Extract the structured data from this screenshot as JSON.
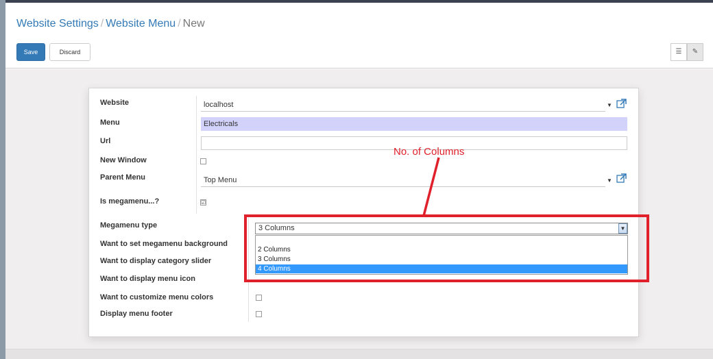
{
  "breadcrumb": {
    "items": [
      "Website Settings",
      "Website Menu"
    ],
    "separator": "/",
    "current": "New"
  },
  "toolbar": {
    "save_label": "Save",
    "discard_label": "Discard"
  },
  "view_switcher": {
    "list_icon": "list-icon",
    "form_icon": "edit-icon",
    "list_glyph": "☰",
    "form_glyph": "✎"
  },
  "form": {
    "website": {
      "label": "Website",
      "value": "localhost",
      "icon": "external-link-icon"
    },
    "menu": {
      "label": "Menu",
      "value": "Electricals"
    },
    "url": {
      "label": "Url",
      "value": ""
    },
    "new_window": {
      "label": "New Window",
      "checked": false
    },
    "parent_menu": {
      "label": "Parent Menu",
      "value": "Top Menu",
      "icon": "external-link-icon"
    },
    "is_megamenu": {
      "label": "Is megamenu...?",
      "checked": true,
      "check_glyph": "☑"
    },
    "megamenu_type": {
      "label": "Megamenu type",
      "value": "3 Columns",
      "options": [
        "2 Columns",
        "3 Columns",
        "4 Columns"
      ],
      "highlighted": "4 Columns"
    },
    "megamenu_background": {
      "label": "Want to set megamenu background"
    },
    "category_slider": {
      "label": "Want to display category slider"
    },
    "menu_icon": {
      "label": "Want to display menu icon"
    },
    "customize_colors": {
      "label": "Want to customize menu colors",
      "checked": false
    },
    "menu_footer": {
      "label": "Display menu footer",
      "checked": false
    }
  },
  "annotation": {
    "text": "No. of Columns",
    "color": "#e0202a"
  },
  "colors": {
    "primary": "#337ab7",
    "required_field": "#d2d2fb",
    "dropdown_highlight": "#3399ff"
  }
}
